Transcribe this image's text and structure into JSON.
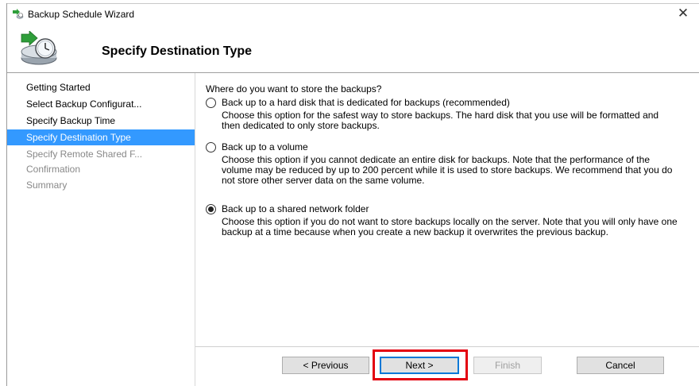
{
  "window": {
    "title": "Backup Schedule Wizard",
    "close_glyph": "✕"
  },
  "header": {
    "title": "Specify Destination Type",
    "icon": "backup-clock-icon"
  },
  "nav": {
    "items": [
      {
        "label": "Getting Started",
        "state": "normal"
      },
      {
        "label": "Select Backup Configurat...",
        "state": "normal"
      },
      {
        "label": "Specify Backup Time",
        "state": "normal"
      },
      {
        "label": "Specify Destination Type",
        "state": "selected"
      },
      {
        "label": "Specify Remote Shared F...",
        "state": "disabled"
      },
      {
        "label": "Confirmation",
        "state": "disabled"
      },
      {
        "label": "Summary",
        "state": "disabled"
      }
    ],
    "selected_color": "#3399ff"
  },
  "content": {
    "question": "Where do you want to store the backups?",
    "options": [
      {
        "label": "Back up to a hard disk that is dedicated for backups (recommended)",
        "description": "Choose this option for the safest way to store backups. The hard disk that you use will be formatted and then dedicated to only store backups.",
        "checked": false
      },
      {
        "label": "Back up to a volume",
        "description": "Choose this option if you cannot dedicate an entire disk for backups. Note that the performance of the volume may be reduced by up to 200 percent while it is used to store backups. We recommend that you do not store other server data on the same volume.",
        "checked": false
      },
      {
        "label": "Back up to a shared network folder",
        "description": "Choose this option if you do not want to store backups locally on the server. Note that you will only have one backup at a time because when you create a new backup it overwrites the previous backup.",
        "checked": true
      }
    ]
  },
  "buttons": {
    "previous": "< Previous",
    "next": "Next >",
    "finish": "Finish",
    "cancel": "Cancel",
    "highlight_color": "#e3000f"
  }
}
